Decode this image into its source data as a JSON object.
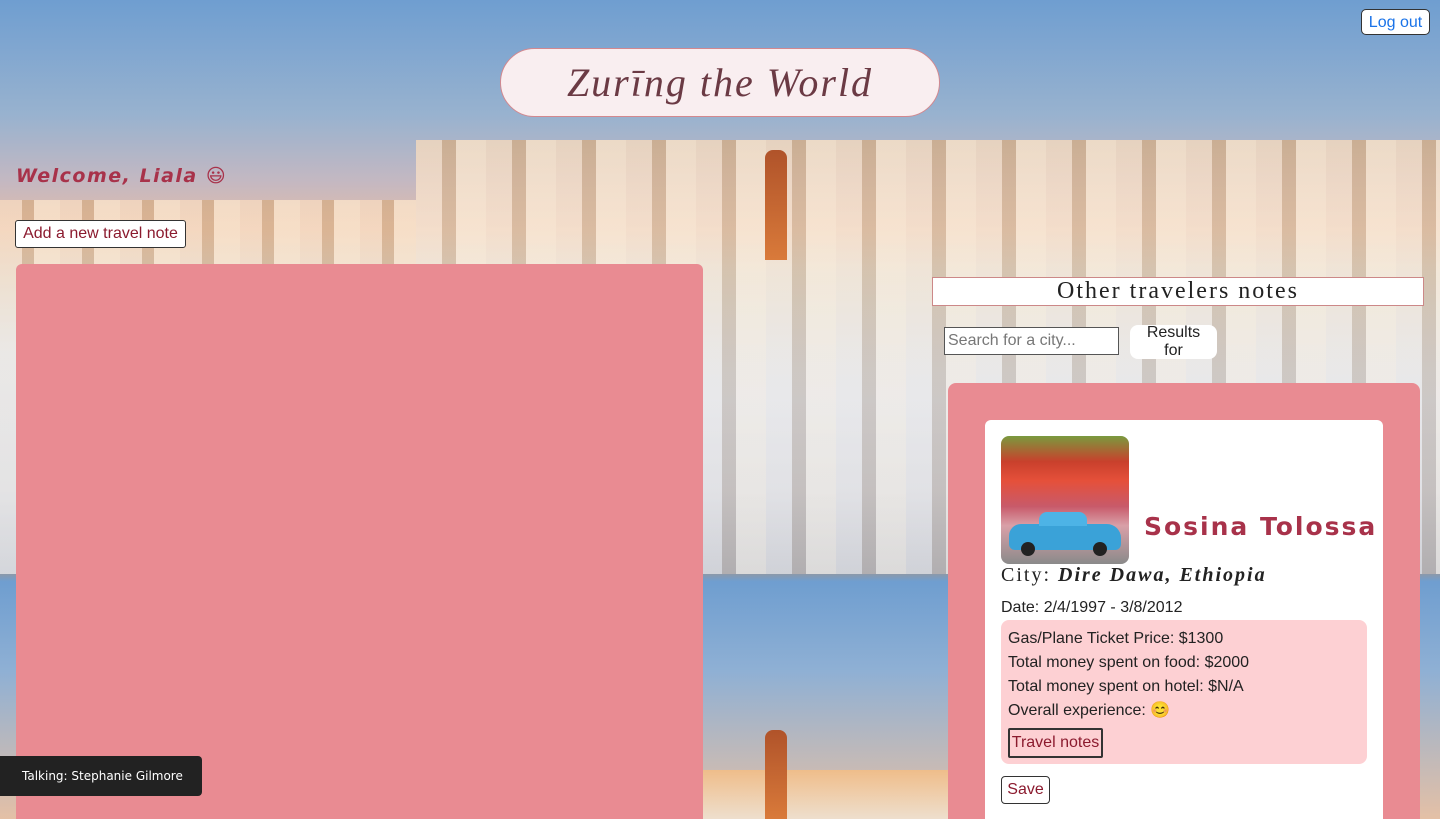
{
  "header": {
    "logout_label": "Log out",
    "app_title": "Zurīng the World"
  },
  "welcome": {
    "text": "Welcome, Liala",
    "emoji": "😃"
  },
  "actions": {
    "add_note_label": "Add a new travel note"
  },
  "others": {
    "heading": "Other travelers notes",
    "search_placeholder": "Search for a city...",
    "results_label": "Results for"
  },
  "note_card": {
    "traveler_name": "Sosina Tolossa",
    "city_prefix": "City:",
    "city": "Dire Dawa, Ethiopia",
    "date": "Date: 2/4/1997 - 3/8/2012",
    "ticket_price": "Gas/Plane Ticket Price: $1300",
    "food_cost": "Total money spent on food: $2000",
    "hotel_cost": "Total money spent on hotel: $N/A",
    "experience_label": "Overall experience:",
    "experience_emoji": "😊",
    "travel_notes_label": "Travel notes",
    "save_label": "Save"
  },
  "status": {
    "talking": "Talking: Stephanie Gilmore"
  },
  "colors": {
    "panel_pink": "#e98b92",
    "accent_red": "#a8324a",
    "link_blue": "#1a73e8"
  }
}
